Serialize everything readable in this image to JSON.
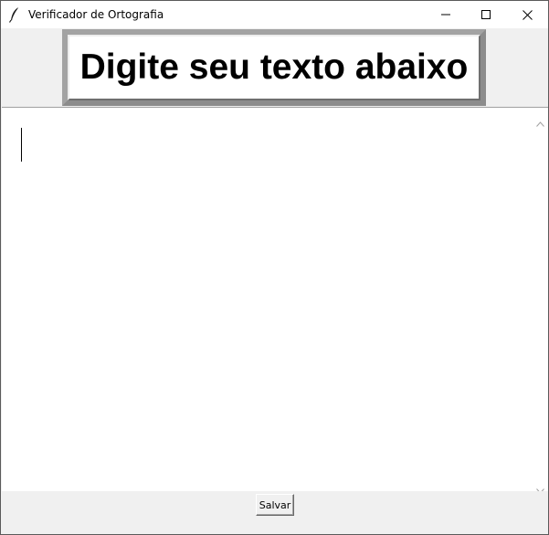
{
  "window": {
    "title": "Verificador de Ortografia",
    "app_icon": "feather-icon",
    "controls": {
      "minimize_icon": "minimize-icon",
      "maximize_icon": "maximize-icon",
      "close_icon": "close-icon"
    }
  },
  "heading": {
    "text": "Digite seu texto abaixo"
  },
  "editor": {
    "value": "",
    "scrollbar": {
      "up_icon": "chevron-up-icon",
      "down_icon": "chevron-down-icon"
    }
  },
  "actions": {
    "save_label": "Salvar"
  }
}
